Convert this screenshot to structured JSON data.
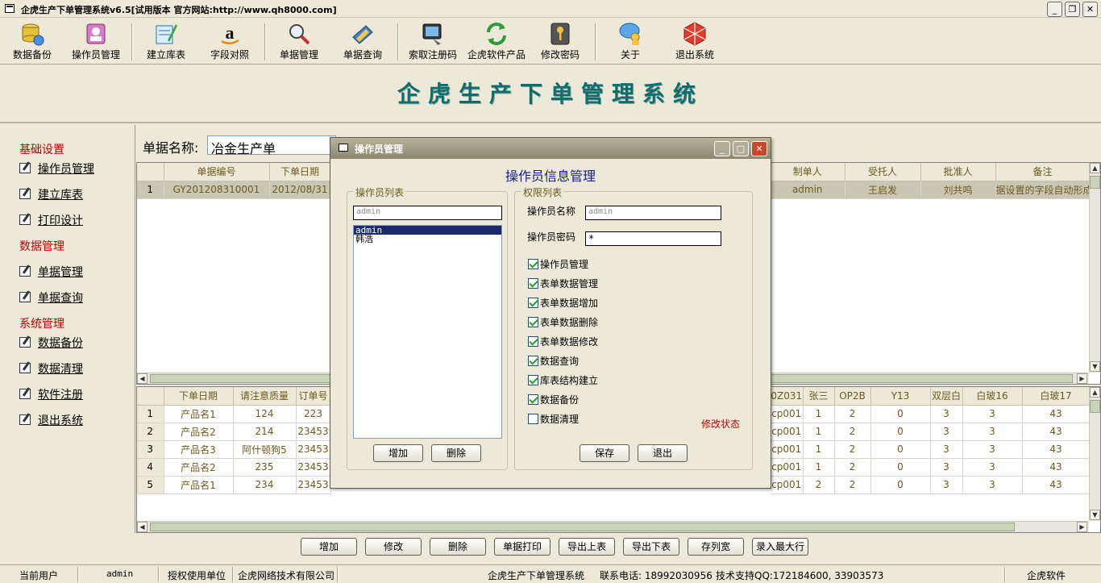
{
  "window": {
    "title": "企虎生产下单管理系统v6.5[试用版本 官方网站:http://www.qh8000.com]"
  },
  "toolbar": [
    {
      "label": "数据备份",
      "icon": "database-backup-icon"
    },
    {
      "label": "操作员管理",
      "icon": "operator-icon"
    },
    {
      "label": "建立库表",
      "icon": "create-table-icon"
    },
    {
      "label": "字段对照",
      "icon": "field-map-icon"
    },
    {
      "label": "单据管理",
      "icon": "magnifier-icon"
    },
    {
      "label": "单据查询",
      "icon": "query-icon"
    },
    {
      "label": "索取注册码",
      "icon": "register-code-icon"
    },
    {
      "label": "企虎软件产品",
      "icon": "refresh-icon"
    },
    {
      "label": "修改密码",
      "icon": "key-icon"
    },
    {
      "label": "关于",
      "icon": "about-icon"
    },
    {
      "label": "退出系统",
      "icon": "exit-icon"
    }
  ],
  "banner": {
    "title": "企虎生产下单管理系统"
  },
  "sidebar": {
    "groups": [
      {
        "title": "基础设置",
        "items": [
          "操作员管理",
          "建立库表",
          "打印设计"
        ]
      },
      {
        "title": "数据管理",
        "items": [
          "单据管理",
          "单据查询"
        ]
      },
      {
        "title": "系统管理",
        "items": [
          "数据备份",
          "数据清理",
          "软件注册",
          "退出系统"
        ]
      }
    ]
  },
  "main": {
    "doc_label": "单据名称:",
    "doc_value": "冶金生产单"
  },
  "upper_grid": {
    "left_headers": [
      "",
      "单据编号",
      "下单日期"
    ],
    "right_headers": [
      "制单人",
      "受托人",
      "批准人",
      "备注"
    ],
    "row": {
      "num": "1",
      "code": "GY201208310001",
      "date": "2012/08/31",
      "maker": "admin",
      "trustee": "王启发",
      "approver": "刘共鸣",
      "note": "据设置的字段自动形成"
    }
  },
  "lower_grid": {
    "left_headers": [
      "",
      "下单日期",
      "请注意质量",
      "订单号"
    ],
    "right_headers": [
      "0Z031",
      "张三",
      "OP2B",
      "Y13",
      "双层白",
      "白玻16",
      "白玻17"
    ],
    "rows": [
      {
        "num": "1",
        "a": "产品名1",
        "b": "124",
        "c": "223",
        "r": [
          "cp001",
          "1",
          "2",
          "0",
          "3",
          "3",
          "43"
        ]
      },
      {
        "num": "2",
        "a": "产品名2",
        "b": "214",
        "c": "23453",
        "r": [
          "cp001",
          "1",
          "2",
          "0",
          "3",
          "3",
          "43"
        ]
      },
      {
        "num": "3",
        "a": "产品名3",
        "b": "阿什顿狗5",
        "c": "23453",
        "r": [
          "cp001",
          "1",
          "2",
          "0",
          "3",
          "3",
          "43"
        ]
      },
      {
        "num": "4",
        "a": "产品名2",
        "b": "235",
        "c": "23453",
        "r": [
          "cp001",
          "1",
          "2",
          "0",
          "3",
          "3",
          "43"
        ]
      },
      {
        "num": "5",
        "a": "产品名1",
        "b": "234",
        "c": "23453",
        "r": [
          "cp001",
          "2",
          "2",
          "0",
          "3",
          "3",
          "43"
        ]
      }
    ]
  },
  "bottom_buttons": [
    "增加",
    "修改",
    "删除",
    "单据打印",
    "导出上表",
    "导出下表",
    "存列宽",
    "录入最大行"
  ],
  "status": {
    "user_label": "当前用户",
    "user": "admin",
    "auth_label": "授权使用单位",
    "auth_unit": "企虎网络技术有限公司",
    "system": "企虎生产下单管理系统",
    "phone": "联系电话: 18992030956",
    "support": "技术支持QQ:172184600, 33903573",
    "brand": "企虎软件"
  },
  "dialog": {
    "title": "操作员管理",
    "heading": "操作员信息管理",
    "list_group": "操作员列表",
    "list_input": "admin",
    "operators": [
      "admin",
      "韩浩"
    ],
    "selected_operator": "admin",
    "perm_group": "权限列表",
    "name_label": "操作员名称",
    "name_value": "admin",
    "pwd_label": "操作员密码",
    "pwd_value": "*",
    "permissions": [
      {
        "label": "操作员管理",
        "checked": true
      },
      {
        "label": "表单数据管理",
        "checked": true
      },
      {
        "label": "表单数据增加",
        "checked": true
      },
      {
        "label": "表单数据删除",
        "checked": true
      },
      {
        "label": "表单数据修改",
        "checked": true
      },
      {
        "label": "数据查询",
        "checked": true
      },
      {
        "label": "库表结构建立",
        "checked": true
      },
      {
        "label": "数据备份",
        "checked": true
      },
      {
        "label": "数据清理",
        "checked": false
      }
    ],
    "modify_state": "修改状态",
    "add_btn": "增加",
    "del_btn": "删除",
    "save_btn": "保存",
    "exit_btn": "退出"
  }
}
